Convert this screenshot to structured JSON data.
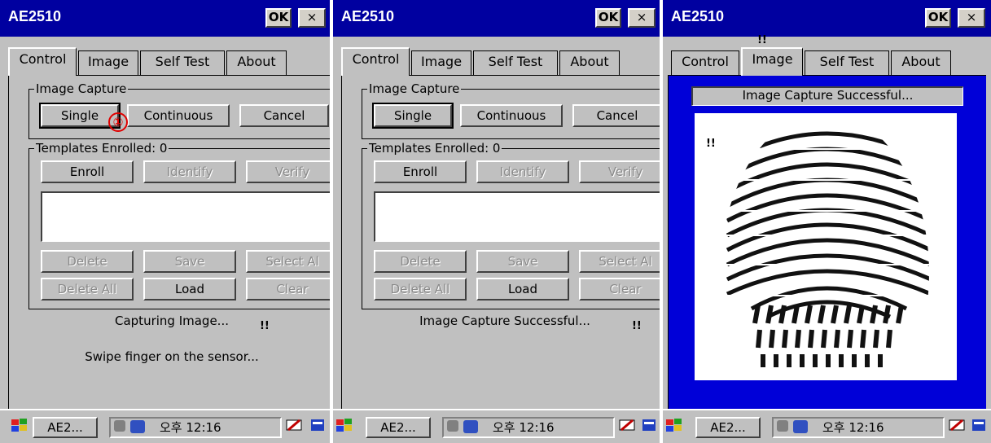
{
  "window": {
    "title": "AE2510",
    "ok_label": "OK",
    "close_label": "×"
  },
  "tabs": [
    "Control",
    "Image",
    "Self Test",
    "About"
  ],
  "image_capture": {
    "group_label": "Image Capture",
    "single": "Single",
    "continuous": "Continuous",
    "cancel": "Cancel"
  },
  "templates": {
    "group_label": "Templates Enrolled: 0",
    "enroll": "Enroll",
    "identify": "Identify",
    "verify": "Verify",
    "delete": "Delete",
    "save": "Save",
    "select_all": "Select Al",
    "delete_all": "Delete All",
    "load": "Load",
    "clear": "Clear"
  },
  "panel1": {
    "status": "Capturing Image...",
    "hint": "Swipe finger on the sensor..."
  },
  "panel2": {
    "status": "Image Capture Successful..."
  },
  "panel3": {
    "banner": "Image Capture Successful..."
  },
  "annotations": {
    "marker": "!!",
    "callout": "①"
  },
  "taskbar": {
    "app_label": "AE2...",
    "time_label": "오후 12:16"
  },
  "icons": {
    "start": "windows-flag-icon",
    "network": "network-icon",
    "speaker": "speaker-muted-icon",
    "input": "input-panel-icon",
    "desktop": "desktop-icon"
  },
  "colors": {
    "titlebar": "#0000a0",
    "image_bg": "#0000d8",
    "window_bg": "#c0c0c0",
    "callout": "#e00000"
  }
}
